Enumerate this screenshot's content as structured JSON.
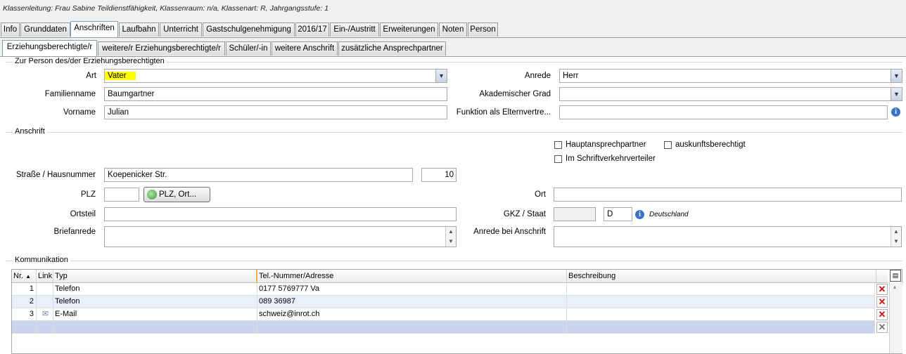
{
  "header": {
    "info_line": "Klassenleitung: Frau Sabine Teildienstfähigkeit, Klassenraum: n/a, Klassenart: R, Jahrgangsstufe: 1"
  },
  "main_tabs": [
    "Info",
    "Grunddaten",
    "Anschriften",
    "Laufbahn",
    "Unterricht",
    "Gastschulgenehmigung",
    "2016/17",
    "Ein-/Austritt",
    "Erweiterungen",
    "Noten",
    "Person"
  ],
  "sub_tabs": [
    "Erziehungsberechtigte/r",
    "weitere/r Erziehungsberechtigte/r",
    "Schüler/-in",
    "weitere Anschrift",
    "zusätzliche Ansprechpartner"
  ],
  "person_group": {
    "title": "Zur Person des/der Erziehungsberechtigten",
    "art_label": "Art",
    "art_value": "Vater",
    "familienname_label": "Familienname",
    "familienname_value": "Baumgartner",
    "vorname_label": "Vorname",
    "vorname_value": "Julian",
    "anrede_label": "Anrede",
    "anrede_value": "Herr",
    "grad_label": "Akademischer Grad",
    "grad_value": "",
    "funktion_label": "Funktion als Elternvertre...",
    "funktion_value": ""
  },
  "anschrift_group": {
    "title": "Anschrift",
    "haupt_label": "Hauptansprechpartner",
    "auskunft_label": "auskunftsberechtigt",
    "schrift_label": "Im Schriftverkehrverteiler",
    "strasse_label": "Straße / Hausnummer",
    "strasse_value": "Koepenicker Str.",
    "hausnummer_value": "10",
    "plz_label": "PLZ",
    "plz_value": "",
    "plz_button": "PLZ, Ort...",
    "ort_label": "Ort",
    "ort_value": "",
    "ortsteil_label": "Ortsteil",
    "ortsteil_value": "",
    "gkz_label": "GKZ / Staat",
    "gkz_value": "",
    "staat_value": "D",
    "staat_name": "Deutschland",
    "briefanrede_label": "Briefanrede",
    "anrede_anschrift_label": "Anrede bei Anschrift"
  },
  "kommunikation": {
    "title": "Kommunikation",
    "columns": [
      "Nr.",
      "Link",
      "Typ",
      "Tel.-Nummer/Adresse",
      "Beschreibung"
    ],
    "rows": [
      {
        "nr": "1",
        "typ": "Telefon",
        "nummer": "0177 5769777 Va",
        "beschreibung": ""
      },
      {
        "nr": "2",
        "typ": "Telefon",
        "nummer": "089 36987",
        "beschreibung": ""
      },
      {
        "nr": "3",
        "typ": "E-Mail",
        "nummer": "schweiz@inrot.ch",
        "beschreibung": ""
      }
    ]
  },
  "colors": {
    "highlight": "#ffff00",
    "tab_active_border": "#7f9db9",
    "delete_red": "#d01010"
  },
  "icons": [
    "combo-arrow-icon",
    "info-icon",
    "globe-icon",
    "mail-icon",
    "delete-icon",
    "sort-asc-icon",
    "column-chooser-icon"
  ]
}
